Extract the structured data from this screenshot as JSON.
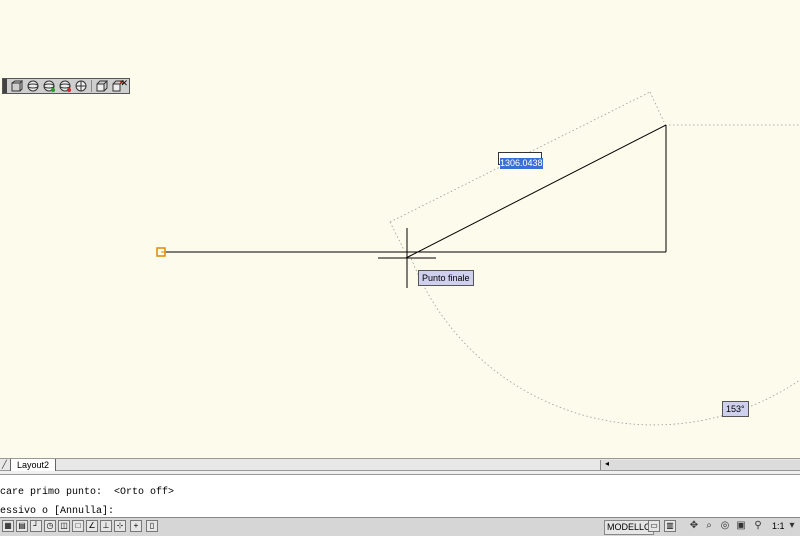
{
  "drawing": {
    "dimension_value": "1306.0438",
    "snap_tooltip": "Punto finale",
    "angle_value": "153°"
  },
  "layout_tabs": {
    "items": [
      "Layout2"
    ]
  },
  "command_line": {
    "line1": "care primo punto:  <Orto off>",
    "line2": "essivo o [Annulla]:"
  },
  "status_bar": {
    "space_label": "MODELLO",
    "annotation_scale": "1:1"
  },
  "colors": {
    "canvas_bg": "#fdfbec",
    "geometry": "#000000",
    "snap_marker": "#e08a00",
    "tooltip_bg": "#cfd0ee"
  }
}
